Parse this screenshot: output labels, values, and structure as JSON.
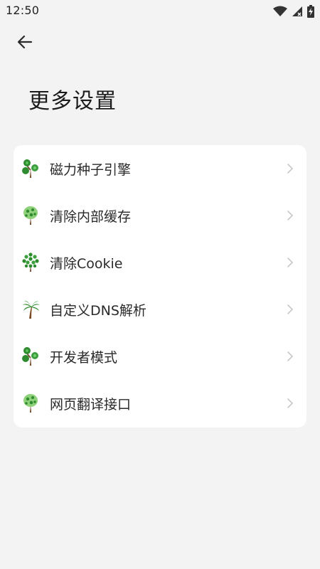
{
  "status_bar": {
    "time": "12:50",
    "icons": [
      "wifi-icon",
      "cellular-signal-icon",
      "battery-charging-icon"
    ]
  },
  "header": {
    "back_icon": "arrow-left-icon",
    "title": "更多设置"
  },
  "settings": {
    "items": [
      {
        "label": "磁力种子引擎",
        "icon": "tree-icon-clover"
      },
      {
        "label": "清除内部缓存",
        "icon": "tree-icon-light-green"
      },
      {
        "label": "清除Cookie",
        "icon": "tree-icon-dotted"
      },
      {
        "label": "自定义DNS解析",
        "icon": "palm-tree-icon"
      },
      {
        "label": "开发者模式",
        "icon": "tree-icon-clover"
      },
      {
        "label": "网页翻译接口",
        "icon": "tree-icon-light-green"
      }
    ],
    "chevron_icon": "chevron-right-icon"
  },
  "colors": {
    "background": "#f3f3f3",
    "card": "#ffffff",
    "text": "#2a2a2a",
    "chevron": "#c8c8c8",
    "leaf_dark": "#2e8b2e",
    "leaf_light": "#8fd17a",
    "trunk": "#6b3e1f"
  }
}
